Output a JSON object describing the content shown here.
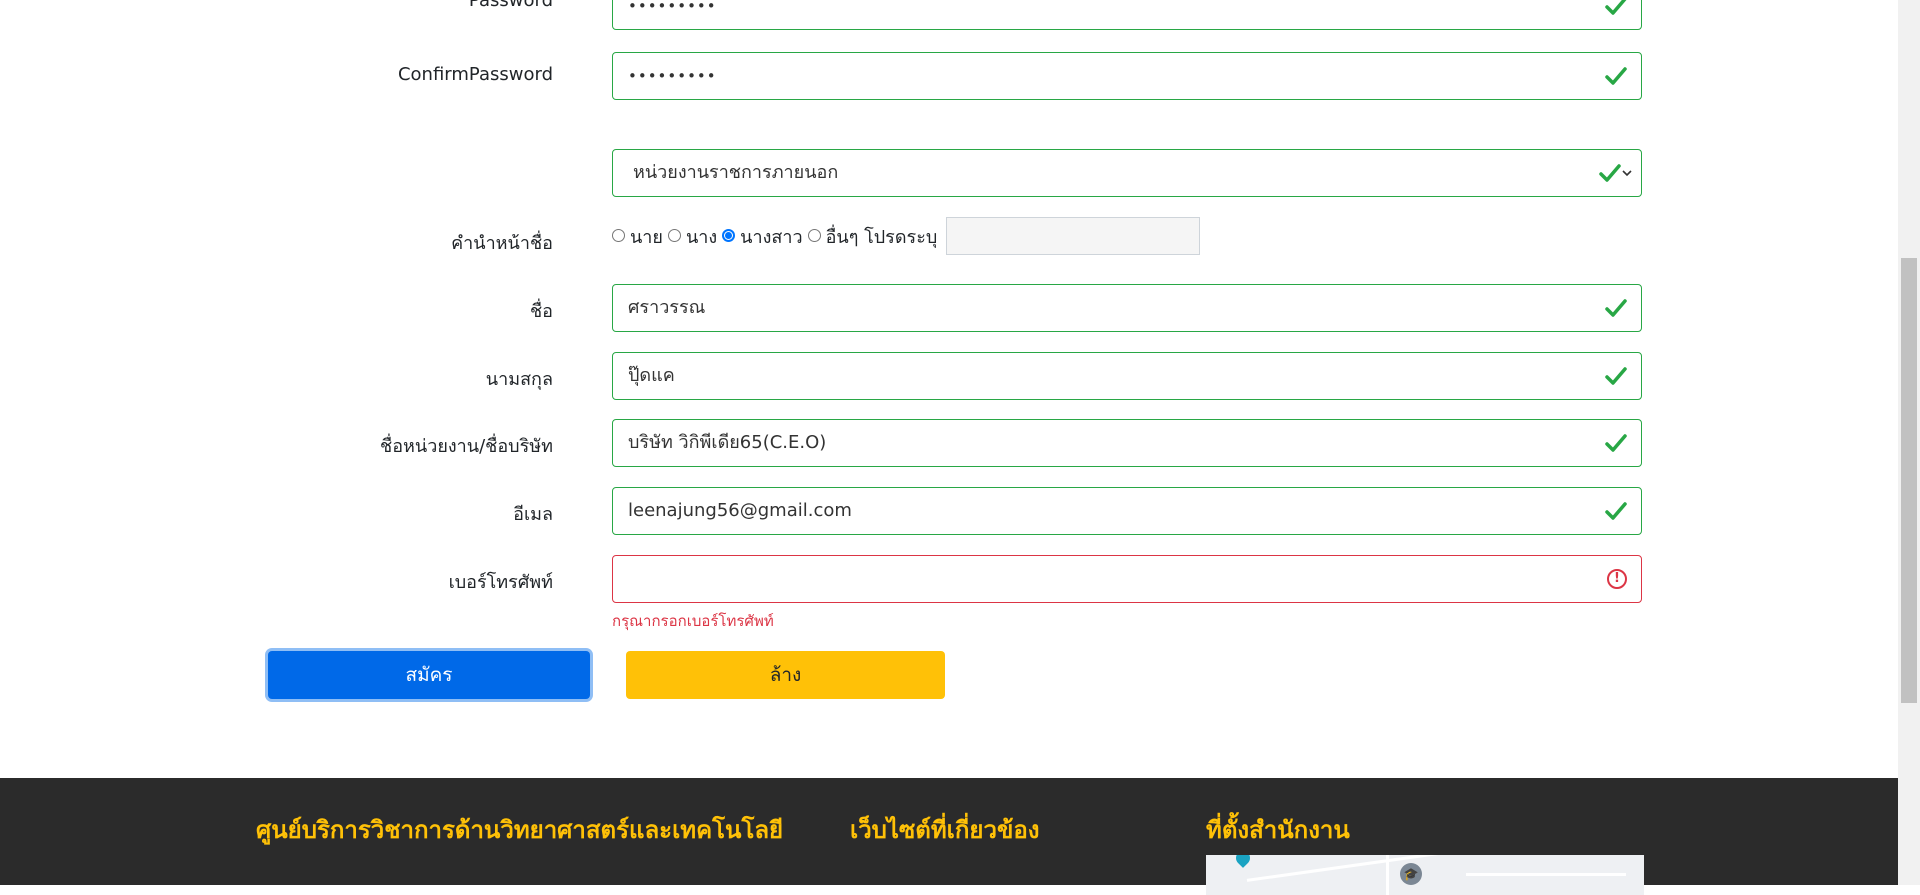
{
  "form": {
    "password": {
      "label": "Password",
      "value": "•••••••••"
    },
    "confirm_password": {
      "label": "ConfirmPassword",
      "value": "•••••••••"
    },
    "agency_select": {
      "value": "หน่วยงานราชการภายนอก"
    },
    "prefix": {
      "label": "คำนำหน้าชื่อ",
      "options": [
        "นาย",
        "นาง",
        "นางสาว",
        "อื่นๆ โปรดระบุ"
      ],
      "selected": "นางสาว"
    },
    "first_name": {
      "label": "ชื่อ",
      "value": "ศราวรรณ"
    },
    "last_name": {
      "label": "นามสกุล",
      "value": "ปุ๊ดแค"
    },
    "company": {
      "label": "ชื่อหน่วยงาน/ชื่อบริษัท",
      "value": "บริษัท วิกิพีเดีย65(C.E.O)"
    },
    "email": {
      "label": "อีเมล",
      "value": "leenajung56@gmail.com"
    },
    "phone": {
      "label": "เบอร์โทรศัพท์",
      "value": "",
      "error": "กรุณากรอกเบอร์โทรศัพท์"
    },
    "submit_label": "สมัคร",
    "reset_label": "ล้าง"
  },
  "footer": {
    "col1_title": "ศูนย์บริการวิชาการด้านวิทยาศาสตร์และเทคโนโลยี",
    "col2_title": "เว็บไซต์ที่เกี่ยวข้อง",
    "col3_title": "ที่ตั้งสำนักงาน"
  },
  "colors": {
    "valid": "#28a745",
    "invalid": "#dc3545",
    "primary": "#0069e8",
    "warning": "#ffc107",
    "footer_bg": "#2b2b2b",
    "footer_heading": "#ffc107"
  },
  "icons": {
    "valid": "check-icon",
    "invalid": "exclamation-circle-icon",
    "select": "chevron-down-icon"
  }
}
